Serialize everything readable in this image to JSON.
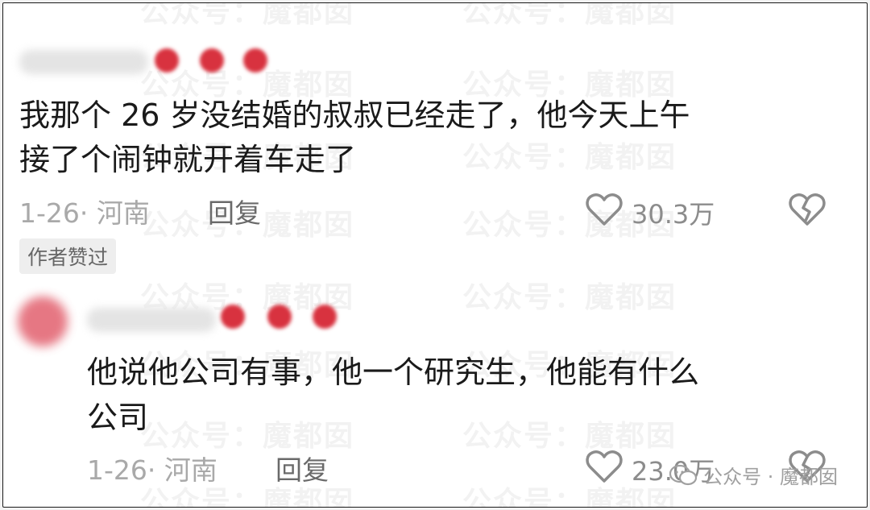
{
  "watermark": {
    "text": "公众号：魔都囡"
  },
  "comments": [
    {
      "text_lines": [
        "我那个 26 岁没结婚的叔叔已经走了，他今天上午",
        "接了个闹钟就开着车走了"
      ],
      "meta": "1-26· 河南",
      "reply_label": "回复",
      "like_count": "30.3万",
      "author_badge": "作者赞过"
    },
    {
      "text_lines": [
        "他说他公司有事，他一个研究生，他能有什么",
        "公司"
      ],
      "meta": "1-26· 河南",
      "reply_label": "回复",
      "like_count": "23.0万"
    }
  ],
  "footer_watermark": {
    "text": "公众号 · 魔都囡"
  },
  "icons": {
    "like": "heart-outline-icon",
    "dislike": "broken-heart-icon",
    "wechat": "wechat-icon"
  }
}
